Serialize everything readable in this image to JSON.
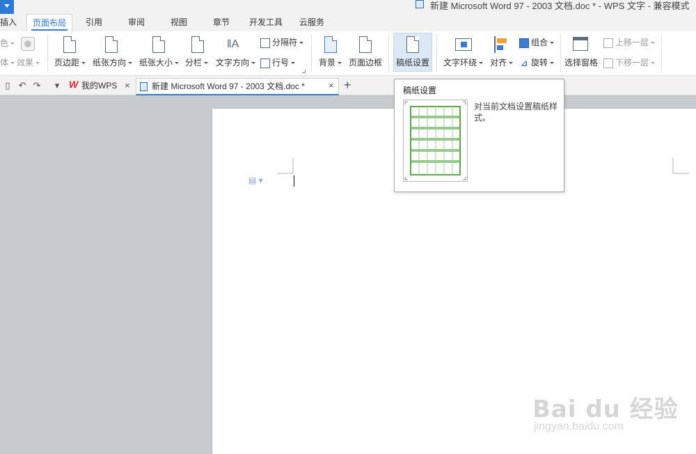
{
  "window": {
    "title": "新建 Microsoft Word 97 - 2003 文档.doc * - WPS 文字 - 兼容模式"
  },
  "menu": {
    "tabs": [
      {
        "label": "插入"
      },
      {
        "label": "页面布局",
        "active": true
      },
      {
        "label": "引用"
      },
      {
        "label": "审阅"
      },
      {
        "label": "视图"
      },
      {
        "label": "章节"
      },
      {
        "label": "开发工具"
      },
      {
        "label": "云服务"
      }
    ]
  },
  "ribbon": {
    "partial_left": [
      "色",
      "体",
      "效果"
    ],
    "page_margin": "页边距",
    "orientation": "纸张方向",
    "paper_size": "纸张大小",
    "columns": "分栏",
    "text_direction": "文字方向",
    "separator": "分隔符",
    "line_number": "行号",
    "background": "背景",
    "page_border": "页面边框",
    "manuscript_setup": "稿纸设置",
    "text_wrap": "文字环绕",
    "align": "对齐",
    "group": "组合",
    "rotate": "旋转",
    "selection_pane": "选择窗格",
    "bring_forward": "上移一层",
    "send_backward": "下移一层"
  },
  "tabs_bar": {
    "home_tab": "我的WPS",
    "doc_tab": "新建 Microsoft Word 97 - 2003 文档.doc *",
    "new_tab": "+",
    "close": "×"
  },
  "tooltip": {
    "title": "稿纸设置",
    "description": "对当前文档设置稿纸样式。"
  },
  "watermark": {
    "brand": "Bai du 经验",
    "url": "jingyan.baidu.com"
  },
  "colors": {
    "accent": "#2f7ad6",
    "grid_green": "#5aa84a",
    "wps_red": "#d9262b"
  }
}
